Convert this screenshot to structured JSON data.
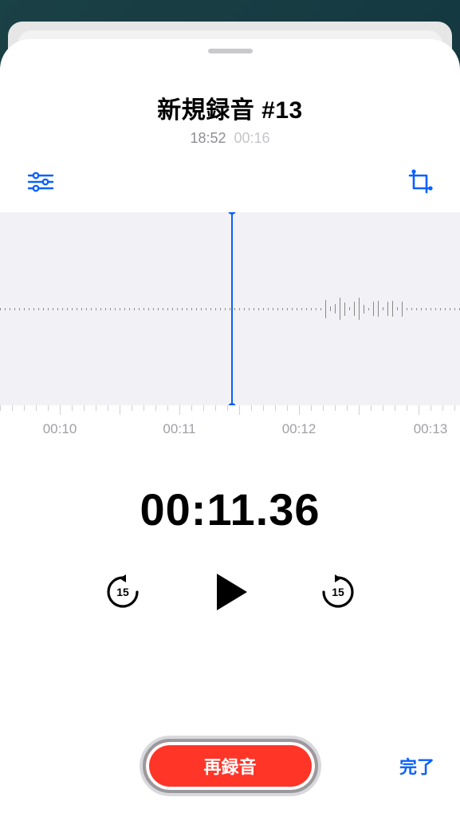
{
  "title": "新規録音 #13",
  "recorded_at": "18:52",
  "total_length": "00:16",
  "ruler": {
    "t0": "00:10",
    "t1": "00:11",
    "t2": "00:12",
    "t3": "00:13"
  },
  "current_time": "00:11.36",
  "skip_seconds": "15",
  "rerecord_label": "再録音",
  "done_label": "完了",
  "colors": {
    "accent": "#0a60ff",
    "record": "#ff3528"
  }
}
